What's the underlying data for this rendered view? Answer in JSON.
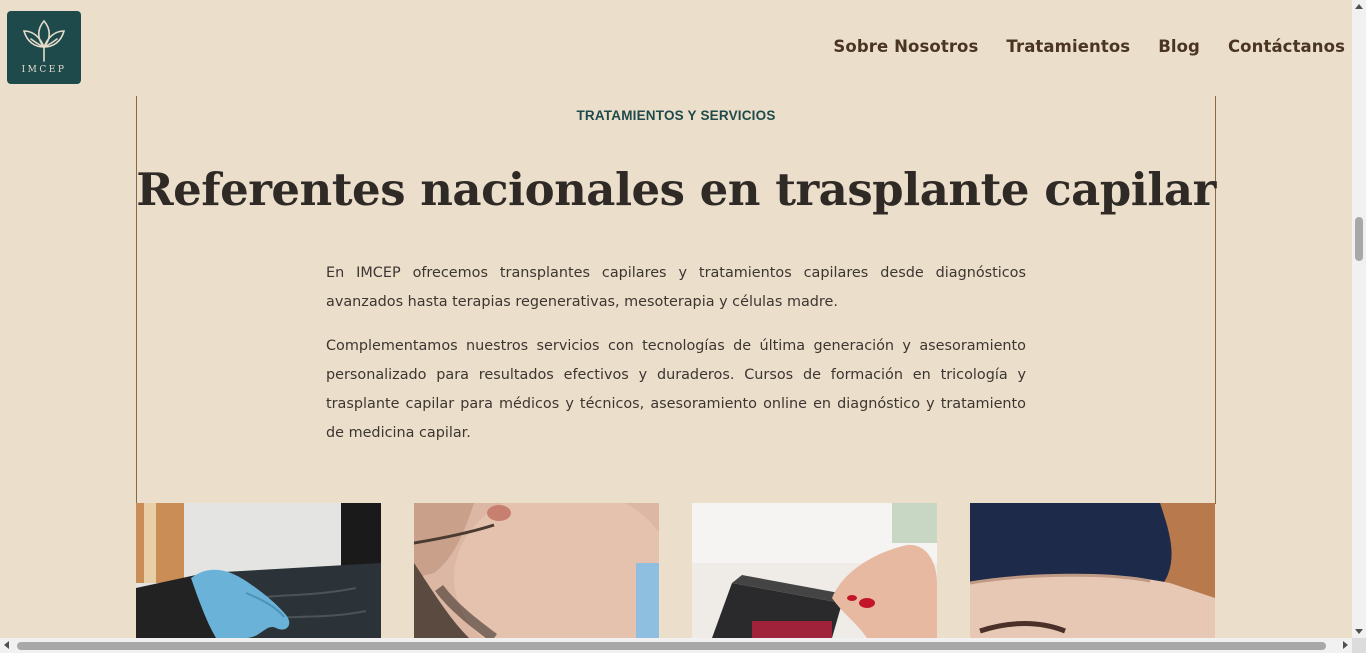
{
  "header": {
    "logo_text": "IMCEP",
    "logo_icon": "leaf-lotus-icon",
    "nav": [
      {
        "label": "Sobre Nosotros"
      },
      {
        "label": "Tratamientos"
      },
      {
        "label": "Blog"
      },
      {
        "label": "Contáctanos"
      }
    ]
  },
  "section": {
    "eyebrow": "TRATAMIENTOS Y SERVICIOS",
    "title": "Referentes nacionales en trasplante capilar",
    "paragraphs": [
      "En IMCEP ofrecemos transplantes capilares y tratamientos capilares desde diagnósticos avanzados hasta terapias regenerativas, mesoterapia y células madre.",
      "Complementamos nuestros servicios con tecnologías de última generación y asesoramiento personalizado para resultados efectivos y duraderos. Cursos de formación en tricología y trasplante capilar para médicos y técnicos, asesoramiento online en diagnóstico y tratamiento de medicina capilar."
    ]
  },
  "cards": [
    {
      "image": "gloved-hand-scalp-photo"
    },
    {
      "image": "man-beard-face-photo"
    },
    {
      "image": "card-payment-terminal-photo"
    },
    {
      "image": "patient-forehead-photo"
    }
  ],
  "colors": {
    "background": "#ebdfcc",
    "brand_teal": "#1f4a4b",
    "nav_text": "#4a3522",
    "frame_line": "#8a6a45"
  }
}
